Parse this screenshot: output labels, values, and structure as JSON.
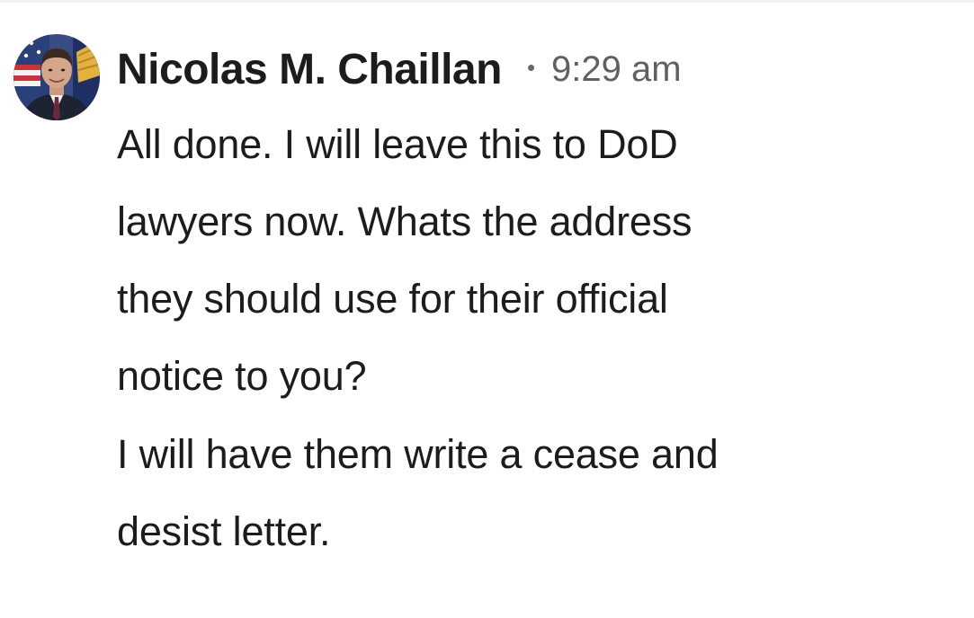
{
  "message": {
    "sender_name": "Nicolas M. Chaillan",
    "separator": "•",
    "timestamp": "9:29 am",
    "lines_para1": [
      "All done. I will leave this to DoD",
      "lawyers now. Whats the address",
      "they should use for their official",
      "notice to you?"
    ],
    "lines_para2": [
      "I will have them write a cease and",
      "desist letter."
    ]
  },
  "colors": {
    "text_primary": "#1d1c1d",
    "text_secondary": "#616061",
    "background": "#ffffff"
  },
  "avatar": {
    "icon": "profile-photo-icon"
  }
}
